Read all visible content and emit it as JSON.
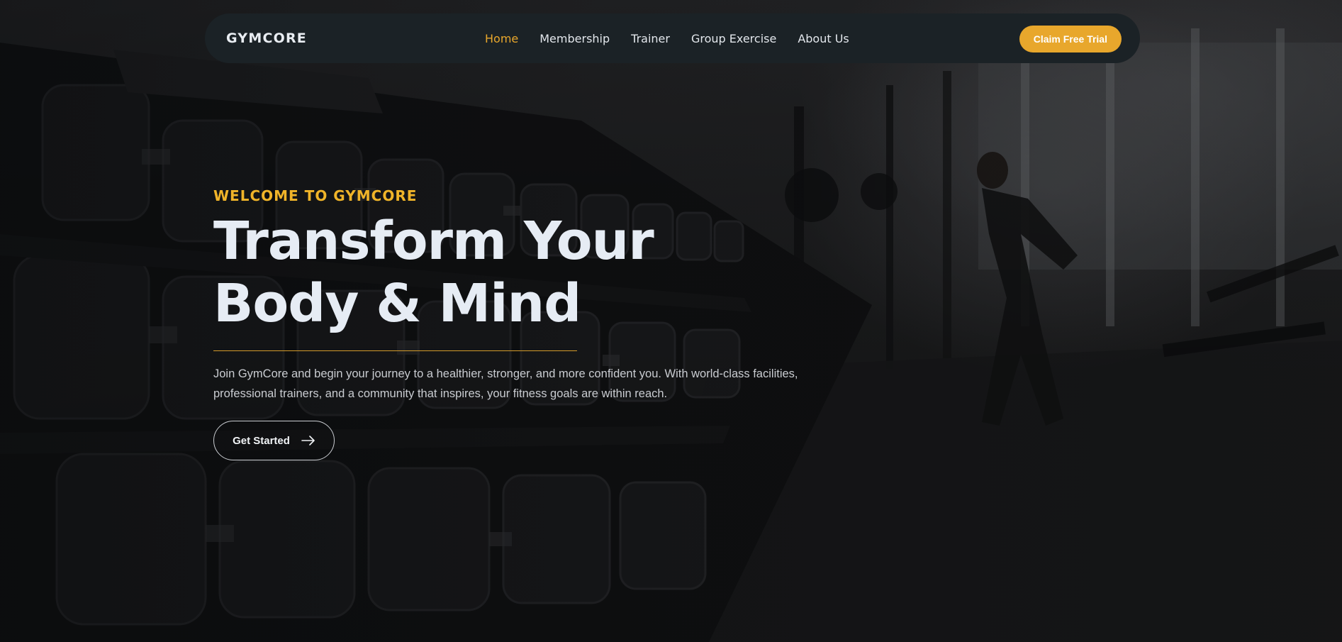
{
  "navbar": {
    "brand": "GYMCORE",
    "links": [
      {
        "label": "Home",
        "active": true
      },
      {
        "label": "Membership",
        "active": false
      },
      {
        "label": "Trainer",
        "active": false
      },
      {
        "label": "Group Exercise",
        "active": false
      },
      {
        "label": "About Us",
        "active": false
      }
    ],
    "cta_label": "Claim Free Trial"
  },
  "hero": {
    "eyebrow": "WELCOME TO GYMCORE",
    "headline_line1": "Transform Your",
    "headline_line2": "Body & Mind",
    "lead": "Join GymCore and begin your journey to a healthier, stronger, and more confident you. With world-class facilities, professional trainers, and a community that inspires, your fitness goals are within reach.",
    "button_label": "Get Started",
    "button_icon": "arrow-right-icon",
    "background_image": "gym-dumbbell-rack-photo"
  },
  "colors": {
    "accent": "#e8a72c",
    "eyebrow": "#f0b429",
    "navbar_bg": "#1b2226",
    "headline": "#e6ecf4"
  }
}
